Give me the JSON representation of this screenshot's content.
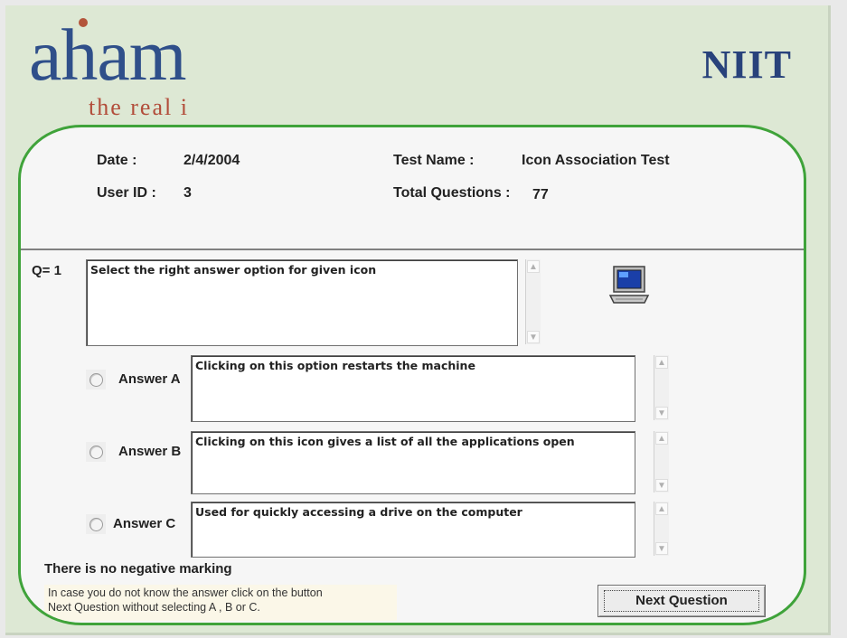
{
  "branding": {
    "logo_text": "aham",
    "tagline": "the real i",
    "company": "NIIT"
  },
  "header": {
    "date_label": "Date :",
    "date_value": "2/4/2004",
    "user_label": "User ID :",
    "user_value": "3",
    "test_name_label": "Test Name :",
    "test_name_value": "Icon Association Test",
    "total_label": "Total Questions :",
    "total_value": "77"
  },
  "question": {
    "label": "Q=  1",
    "text": "Select the right answer option for given icon",
    "icon": "computer-monitor-icon"
  },
  "answers": [
    {
      "label": "Answer A",
      "text": "Clicking on this option restarts the machine",
      "selected": false
    },
    {
      "label": "Answer B",
      "text": "Clicking on this icon gives a list of all the applications open",
      "selected": false
    },
    {
      "label": "Answer C",
      "text": "Used for quickly accessing a drive on the computer",
      "selected": false
    }
  ],
  "footer": {
    "no_negative": "There is no negative marking",
    "hint_line1": "In case you do not know the answer click on the button",
    "hint_line2": "Next Question without selecting A , B or C.",
    "next_button": "Next Question"
  },
  "colors": {
    "background": "#dde8d4",
    "panel_border": "#3fa33a",
    "logo": "#2f4f8a",
    "tagline": "#b24d3a",
    "company": "#28427b"
  }
}
